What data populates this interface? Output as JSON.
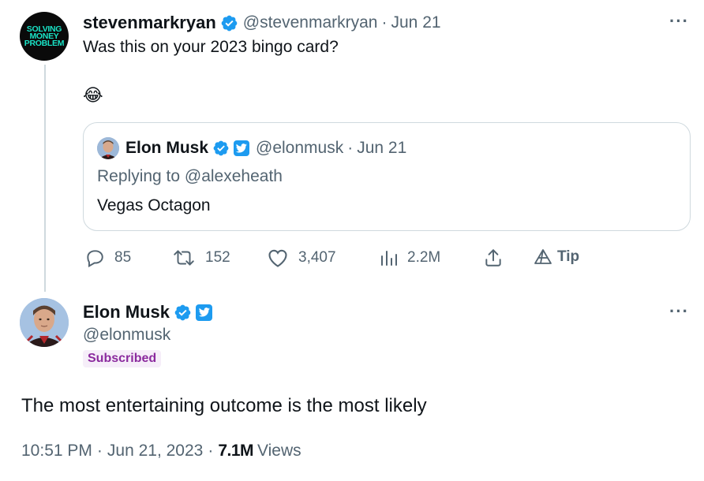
{
  "parent_tweet": {
    "avatar_lines": [
      "SOLVING",
      "MONEY",
      "PROBLEM"
    ],
    "display_name": "stevenmarkryan",
    "handle": "@stevenmarkryan",
    "separator": "·",
    "date": "Jun 21",
    "text": "Was this on your 2023 bingo card?",
    "emoji": "😂",
    "more": "···",
    "quoted": {
      "display_name": "Elon Musk",
      "handle": "@elonmusk",
      "separator": "·",
      "date": "Jun 21",
      "replying_to": "Replying to @alexeheath",
      "text": "Vegas Octagon"
    },
    "actions": {
      "replies": "85",
      "retweets": "152",
      "likes": "3,407",
      "views": "2.2M",
      "tip": "Tip"
    }
  },
  "main_tweet": {
    "display_name": "Elon Musk",
    "handle": "@elonmusk",
    "badge": "Subscribed",
    "more": "···",
    "text": "The most entertaining outcome is the most likely",
    "time": "10:51 PM",
    "date": "Jun 21, 2023",
    "views_count": "7.1M",
    "views_label": "Views",
    "separator": "·"
  },
  "colors": {
    "verified_blue": "#1d9bf0",
    "muted_text": "#536471",
    "border": "#cfd9de",
    "subscribed_text": "#8b2a9e"
  }
}
